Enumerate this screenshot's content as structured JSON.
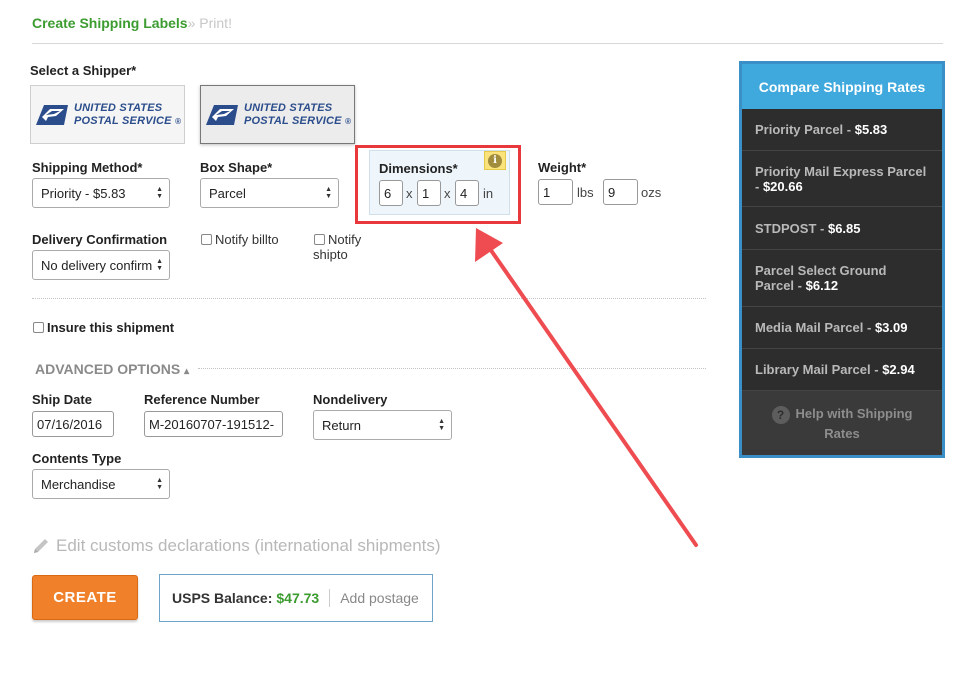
{
  "breadcrumb": {
    "current": "Create Shipping Labels",
    "separator": "»",
    "next": "Print!"
  },
  "shipper": {
    "label": "Select a Shipper*",
    "options": [
      {
        "line1": "UNITED STATES",
        "line2": "POSTAL SERVICE",
        "trademark": "®",
        "selected": false
      },
      {
        "line1": "UNITED STATES",
        "line2": "POSTAL SERVICE",
        "trademark": "®",
        "selected": true
      }
    ]
  },
  "shipping_method": {
    "label": "Shipping Method*",
    "value": "Priority - $5.83"
  },
  "box_shape": {
    "label": "Box Shape*",
    "value": "Parcel"
  },
  "dimensions": {
    "label": "Dimensions*",
    "length": "6",
    "width": "1",
    "height": "4",
    "separator": "x",
    "unit": "in",
    "info_icon": "info-icon"
  },
  "weight": {
    "label": "Weight*",
    "lbs": "1",
    "lbs_unit": "lbs",
    "ozs": "9",
    "ozs_unit": "ozs"
  },
  "delivery_confirmation": {
    "label": "Delivery Confirmation",
    "value": "No delivery confirm"
  },
  "notify_billto": {
    "label": "Notify billto",
    "checked": false
  },
  "notify_shipto": {
    "label_line1": "Notify",
    "label_line2": "shipto",
    "checked": false
  },
  "insure": {
    "label": "Insure this shipment",
    "checked": false
  },
  "advanced": {
    "title": "ADVANCED OPTIONS",
    "caret": "▴",
    "ship_date": {
      "label": "Ship Date",
      "value": "07/16/2016"
    },
    "reference_number": {
      "label": "Reference Number",
      "value": "M-20160707-191512-"
    },
    "nondelivery": {
      "label": "Nondelivery",
      "value": "Return"
    },
    "contents_type": {
      "label": "Contents Type",
      "value": "Merchandise"
    }
  },
  "customs": {
    "label": "Edit customs declarations (international shipments)",
    "icon": "pencil-icon"
  },
  "create_button": {
    "label": "CREATE"
  },
  "balance": {
    "label": "USPS Balance:",
    "value": "$47.73",
    "add_postage": "Add postage"
  },
  "rates": {
    "title": "Compare Shipping Rates",
    "items": [
      {
        "name": "Priority Parcel",
        "sep": " - ",
        "price": "$5.83"
      },
      {
        "name": "Priority Mail Express Parcel",
        "sep": " - ",
        "price": "$20.66"
      },
      {
        "name": "STDPOST",
        "sep": " - ",
        "price": "$6.85"
      },
      {
        "name": "Parcel Select Ground Parcel",
        "sep": " - ",
        "price": "$6.12"
      },
      {
        "name": "Media Mail Parcel",
        "sep": " - ",
        "price": "$3.09"
      },
      {
        "name": "Library Mail Parcel",
        "sep": " - ",
        "price": "$2.94"
      }
    ],
    "help_icon": "?",
    "help_line1": "Help with Shipping",
    "help_line2": "Rates"
  },
  "colors": {
    "brand_green": "#3c9c30",
    "accent_orange": "#f0802a",
    "highlight_red": "#e8383c",
    "rates_blue": "#3fa8dc",
    "rates_bg": "#2d2d2d",
    "usps_blue": "#2b4d8c"
  }
}
